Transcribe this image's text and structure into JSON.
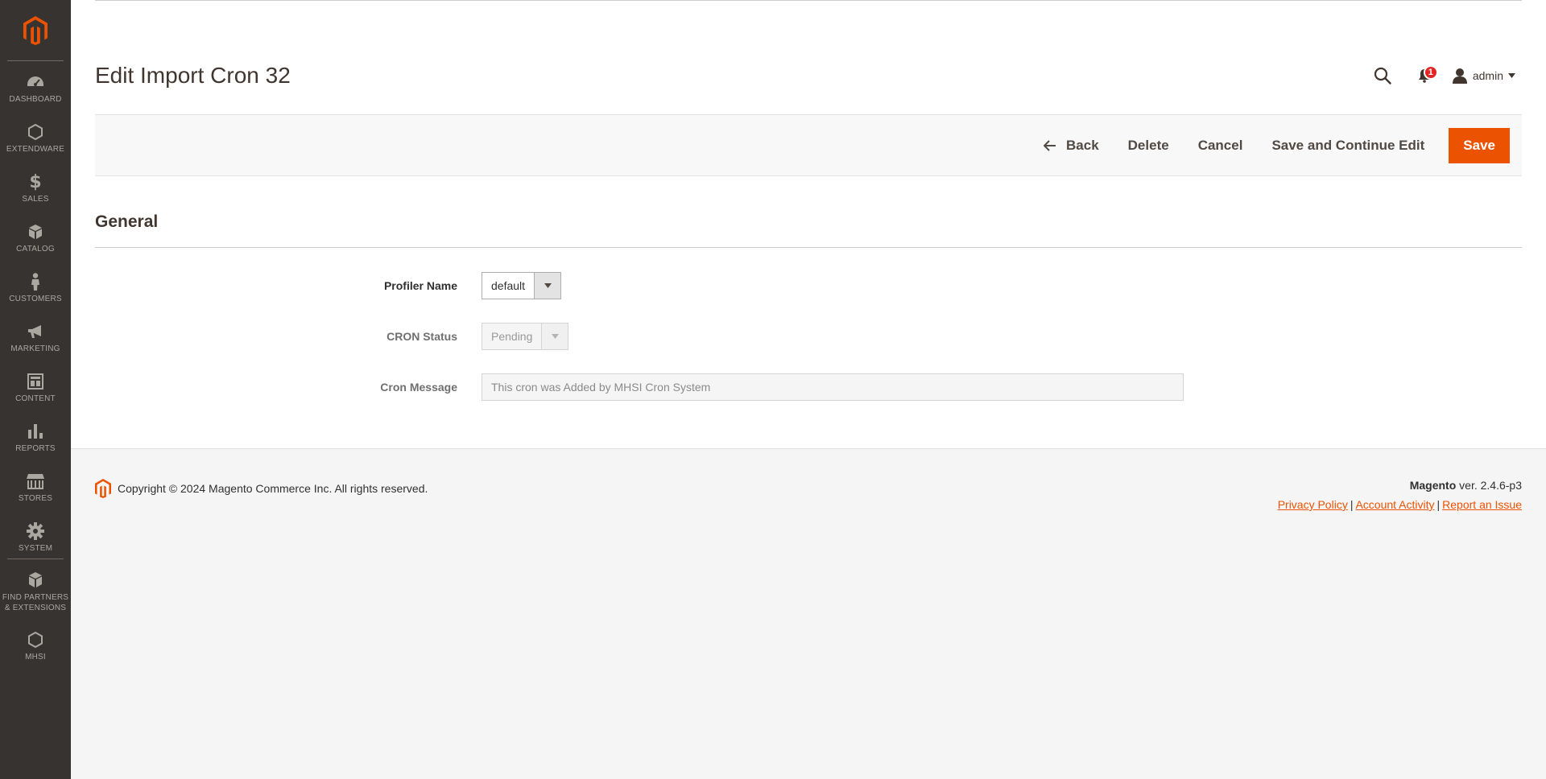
{
  "sidebar": {
    "items": [
      {
        "label": "DASHBOARD",
        "icon": "dashboard-icon"
      },
      {
        "label": "EXTENDWARE",
        "icon": "hexagon-icon"
      },
      {
        "label": "SALES",
        "icon": "dollar-icon"
      },
      {
        "label": "CATALOG",
        "icon": "box-icon"
      },
      {
        "label": "CUSTOMERS",
        "icon": "person-icon"
      },
      {
        "label": "MARKETING",
        "icon": "megaphone-icon"
      },
      {
        "label": "CONTENT",
        "icon": "layout-icon"
      },
      {
        "label": "REPORTS",
        "icon": "bar-chart-icon"
      },
      {
        "label": "STORES",
        "icon": "store-icon"
      },
      {
        "label": "SYSTEM",
        "icon": "gear-icon"
      },
      {
        "label": "FIND PARTNERS & EXTENSIONS",
        "icon": "boxes-icon"
      },
      {
        "label": "MHSI",
        "icon": "hexagon-icon"
      }
    ]
  },
  "header": {
    "title": "Edit Import Cron 32",
    "notification_count": "1",
    "user_name": "admin"
  },
  "actions": {
    "back": "Back",
    "delete": "Delete",
    "cancel": "Cancel",
    "save_continue": "Save and Continue Edit",
    "save": "Save"
  },
  "form": {
    "section_title": "General",
    "profiler_name": {
      "label": "Profiler Name",
      "value": "default"
    },
    "cron_status": {
      "label": "CRON Status",
      "value": "Pending"
    },
    "cron_message": {
      "label": "Cron Message",
      "value": "This cron was Added by MHSI Cron System"
    }
  },
  "footer": {
    "copyright": "Copyright © 2024 Magento Commerce Inc. All rights reserved.",
    "brand": "Magento",
    "version": " ver. 2.4.6-p3",
    "links": [
      "Privacy Policy",
      "Account Activity",
      "Report an Issue"
    ]
  },
  "colors": {
    "accent": "#eb5202",
    "sidebar_bg": "#373330",
    "badge": "#e22626"
  }
}
